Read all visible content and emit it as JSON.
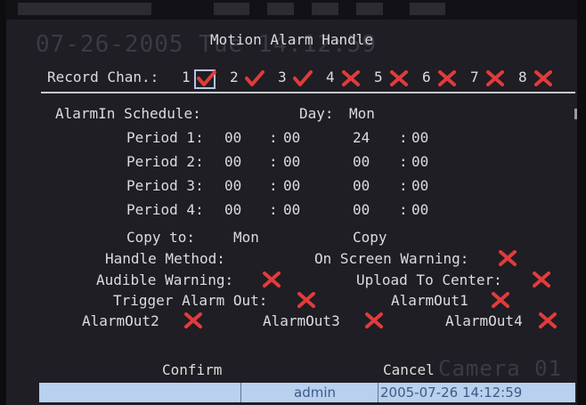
{
  "overlay": {
    "date_time": "07-26-2005 Tue 14:12:59",
    "camera_name": "Camera 01"
  },
  "dialog": {
    "title": "Motion Alarm Handle",
    "record_channel_label": "Record Chan.:",
    "channels": [
      {
        "number": "1",
        "state": "checked"
      },
      {
        "number": "2",
        "state": "checked"
      },
      {
        "number": "3",
        "state": "checked"
      },
      {
        "number": "4",
        "state": "unchecked"
      },
      {
        "number": "5",
        "state": "unchecked"
      },
      {
        "number": "6",
        "state": "unchecked"
      },
      {
        "number": "7",
        "state": "unchecked"
      },
      {
        "number": "8",
        "state": "unchecked"
      }
    ],
    "schedule": {
      "label": "AlarmIn Schedule:",
      "day_label": "Day:",
      "day_value": "Mon",
      "periods": [
        {
          "label": "Period 1:",
          "start_h": "00",
          "start_m": "00",
          "end_h": "24",
          "end_m": "00"
        },
        {
          "label": "Period 2:",
          "start_h": "00",
          "start_m": "00",
          "end_h": "00",
          "end_m": "00"
        },
        {
          "label": "Period 3:",
          "start_h": "00",
          "start_m": "00",
          "end_h": "00",
          "end_m": "00"
        },
        {
          "label": "Period 4:",
          "start_h": "00",
          "start_m": "00",
          "end_h": "00",
          "end_m": "00"
        }
      ],
      "copy_to_label": "Copy to:",
      "copy_to_value": "Mon",
      "copy_button": "Copy"
    },
    "handle": {
      "method_label": "Handle Method:",
      "on_screen_warning": "On Screen Warning:",
      "audible_warning": "Audible Warning:",
      "upload_to_center": "Upload To Center:",
      "trigger_alarm_out": "Trigger Alarm Out:",
      "alarm_out_1": "AlarmOut1",
      "alarm_out_2": "AlarmOut2",
      "alarm_out_3": "AlarmOut3",
      "alarm_out_4": "AlarmOut4"
    },
    "confirm_label": "Confirm",
    "cancel_label": "Cancel"
  },
  "status_bar": {
    "user": "admin",
    "timestamp": "2005-07-26 14:12:59"
  },
  "colors": {
    "check": "#e23b3b",
    "cross": "#e23b3b",
    "status_bg": "#b9d0ee",
    "status_text": "#3a5c86"
  },
  "icons": {
    "checked": "red-checkmark-icon",
    "unchecked": "red-cross-icon"
  }
}
